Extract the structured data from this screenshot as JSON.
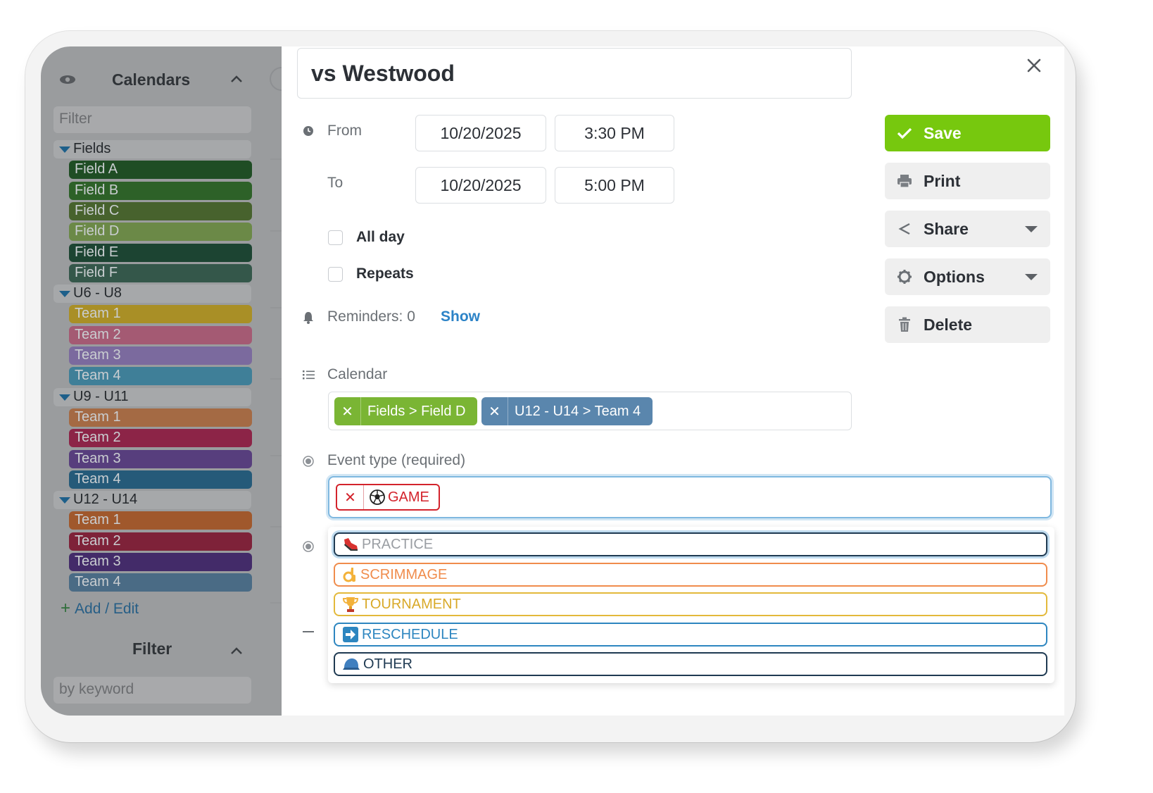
{
  "sidebar": {
    "calendars_title": "Calendars",
    "filter_placeholder": "Filter",
    "groups": [
      {
        "name": "Fields",
        "items": [
          {
            "label": "Field A",
            "color": "#1f4d24"
          },
          {
            "label": "Field B",
            "color": "#2d6128"
          },
          {
            "label": "Field C",
            "color": "#47622d"
          },
          {
            "label": "Field D",
            "color": "#6b8947"
          },
          {
            "label": "Field E",
            "color": "#1c4432"
          },
          {
            "label": "Field F",
            "color": "#34574a"
          }
        ]
      },
      {
        "name": "U6 - U8",
        "items": [
          {
            "label": "Team 1",
            "color": "#a98f26"
          },
          {
            "label": "Team 2",
            "color": "#a45a73"
          },
          {
            "label": "Team 3",
            "color": "#7b6a9e"
          },
          {
            "label": "Team 4",
            "color": "#3f7f98"
          }
        ]
      },
      {
        "name": "U9 - U11",
        "items": [
          {
            "label": "Team 1",
            "color": "#a46a44"
          },
          {
            "label": "Team 2",
            "color": "#8c2447"
          },
          {
            "label": "Team 3",
            "color": "#573e7d"
          },
          {
            "label": "Team 4",
            "color": "#255a79"
          }
        ]
      },
      {
        "name": "U12 - U14",
        "items": [
          {
            "label": "Team 1",
            "color": "#a0582c"
          },
          {
            "label": "Team 2",
            "color": "#7e2239"
          },
          {
            "label": "Team 3",
            "color": "#432b69"
          },
          {
            "label": "Team 4",
            "color": "#4a6b85"
          }
        ]
      }
    ],
    "add_edit": "Add / Edit",
    "filter_title": "Filter",
    "keyword_placeholder": "by keyword"
  },
  "event": {
    "title": "vs Westwood",
    "from_label": "From",
    "from_date": "10/20/2025",
    "from_time": "3:30 PM",
    "to_label": "To",
    "to_date": "10/20/2025",
    "to_time": "5:00 PM",
    "all_day_label": "All day",
    "repeats_label": "Repeats",
    "reminders_label": "Reminders: 0",
    "reminders_link": "Show",
    "calendar_label": "Calendar",
    "calendar_tags": [
      {
        "label": "Fields > Field D",
        "color": "#7ab534"
      },
      {
        "label": "U12 - U14 > Team 4",
        "color": "#5a86ad"
      }
    ],
    "event_type_label": "Event type (required)",
    "selected_type": "GAME",
    "type_options": [
      {
        "label": "PRACTICE",
        "icon": "shoe-icon",
        "border": "#1f3a52",
        "text": "#9a9ea3"
      },
      {
        "label": "SCRIMMAGE",
        "icon": "ok-hand-icon",
        "border": "#f08c4c",
        "text": "#f08c4c"
      },
      {
        "label": "TOURNAMENT",
        "icon": "trophy-icon",
        "border": "#e3b93b",
        "text": "#d9a928"
      },
      {
        "label": "RESCHEDULE",
        "icon": "arrow-right-icon",
        "border": "#2d86c0",
        "text": "#2d86c0"
      },
      {
        "label": "OTHER",
        "icon": "cap-icon",
        "border": "#1f3a52",
        "text": "#1f3a52"
      }
    ]
  },
  "actions": {
    "save": "Save",
    "print": "Print",
    "share": "Share",
    "options": "Options",
    "delete": "Delete",
    "save_color": "#77c80e"
  }
}
